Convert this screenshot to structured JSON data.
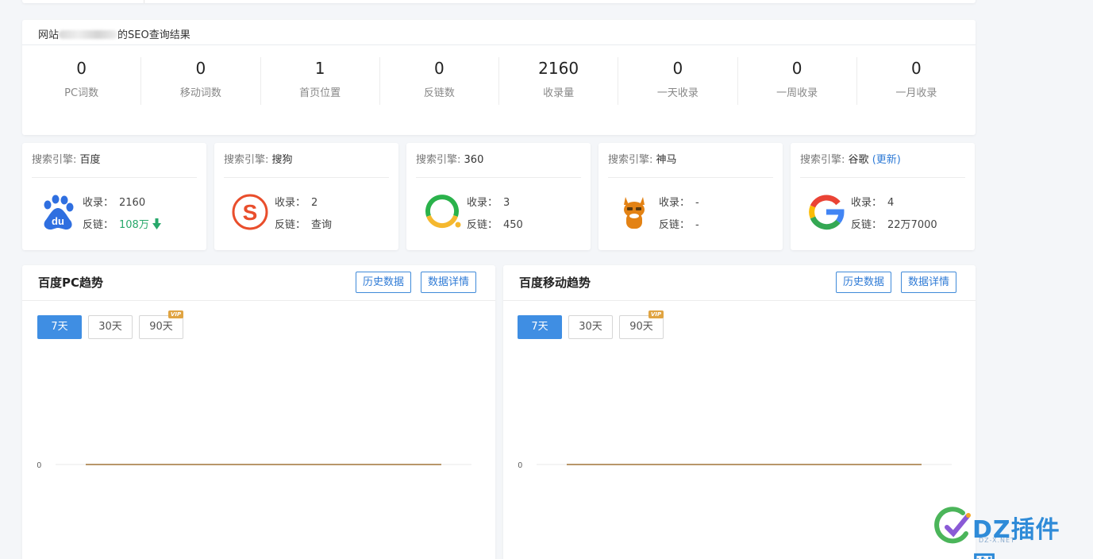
{
  "summary": {
    "title_prefix": "网站",
    "title_middle": "www.",
    "title_suffix": "的SEO查询结果",
    "stats": [
      {
        "value": "0",
        "label": "PC词数"
      },
      {
        "value": "0",
        "label": "移动词数"
      },
      {
        "value": "1",
        "label": "首页位置"
      },
      {
        "value": "0",
        "label": "反链数"
      },
      {
        "value": "2160",
        "label": "收录量"
      },
      {
        "value": "0",
        "label": "一天收录"
      },
      {
        "value": "0",
        "label": "一周收录"
      },
      {
        "value": "0",
        "label": "一月收录"
      }
    ]
  },
  "engines": [
    {
      "prefix": "搜索引擎:",
      "name": "百度",
      "icon": "baidu-logo-icon",
      "index_label": "收录：",
      "index": "2160",
      "backlink_label": "反链：",
      "backlink": "108万"
    },
    {
      "prefix": "搜索引擎:",
      "name": "搜狗",
      "icon": "sogou-logo-icon",
      "index_label": "收录：",
      "index": "2",
      "backlink_label": "反链：",
      "backlink": "查询"
    },
    {
      "prefix": "搜索引擎:",
      "name": "360",
      "icon": "so360-logo-icon",
      "index_label": "收录：",
      "index": "3",
      "backlink_label": "反链：",
      "backlink": "450"
    },
    {
      "prefix": "搜索引擎:",
      "name": "神马",
      "icon": "shenma-logo-icon",
      "index_label": "收录：",
      "index": "-",
      "backlink_label": "反链：",
      "backlink": "-"
    },
    {
      "prefix": "搜索引擎:",
      "name": "谷歌",
      "update_link": "(更新)",
      "icon": "google-logo-icon",
      "index_label": "收录：",
      "index": "4",
      "backlink_label": "反链：",
      "backlink": "22万7000"
    }
  ],
  "trends": [
    {
      "title": "百度PC趋势",
      "history_btn": "历史数据",
      "detail_btn": "数据详情",
      "ranges": [
        "7天",
        "30天",
        "90天"
      ],
      "active_range": "7天",
      "vip_badge": "VIP"
    },
    {
      "title": "百度移动趋势",
      "history_btn": "历史数据",
      "detail_btn": "数据详情",
      "ranges": [
        "7天",
        "30天",
        "90天"
      ],
      "active_range": "7天",
      "vip_badge": "VIP"
    }
  ],
  "chart_data": [
    {
      "type": "line",
      "title": "百度PC趋势",
      "x": [],
      "series": [
        {
          "values": [
            0,
            0,
            0,
            0,
            0,
            0,
            0
          ]
        }
      ],
      "y_ticks": [
        "0"
      ],
      "color": "#b8966a",
      "grid": true
    },
    {
      "type": "line",
      "title": "百度移动趋势",
      "x": [],
      "series": [
        {
          "values": [
            0,
            0,
            0,
            0,
            0,
            0,
            0
          ]
        }
      ],
      "y_ticks": [
        "0"
      ],
      "color": "#b8966a",
      "grid": true
    }
  ],
  "watermark": {
    "text": "DZ插件网",
    "sub": "DZ-X.NET"
  }
}
